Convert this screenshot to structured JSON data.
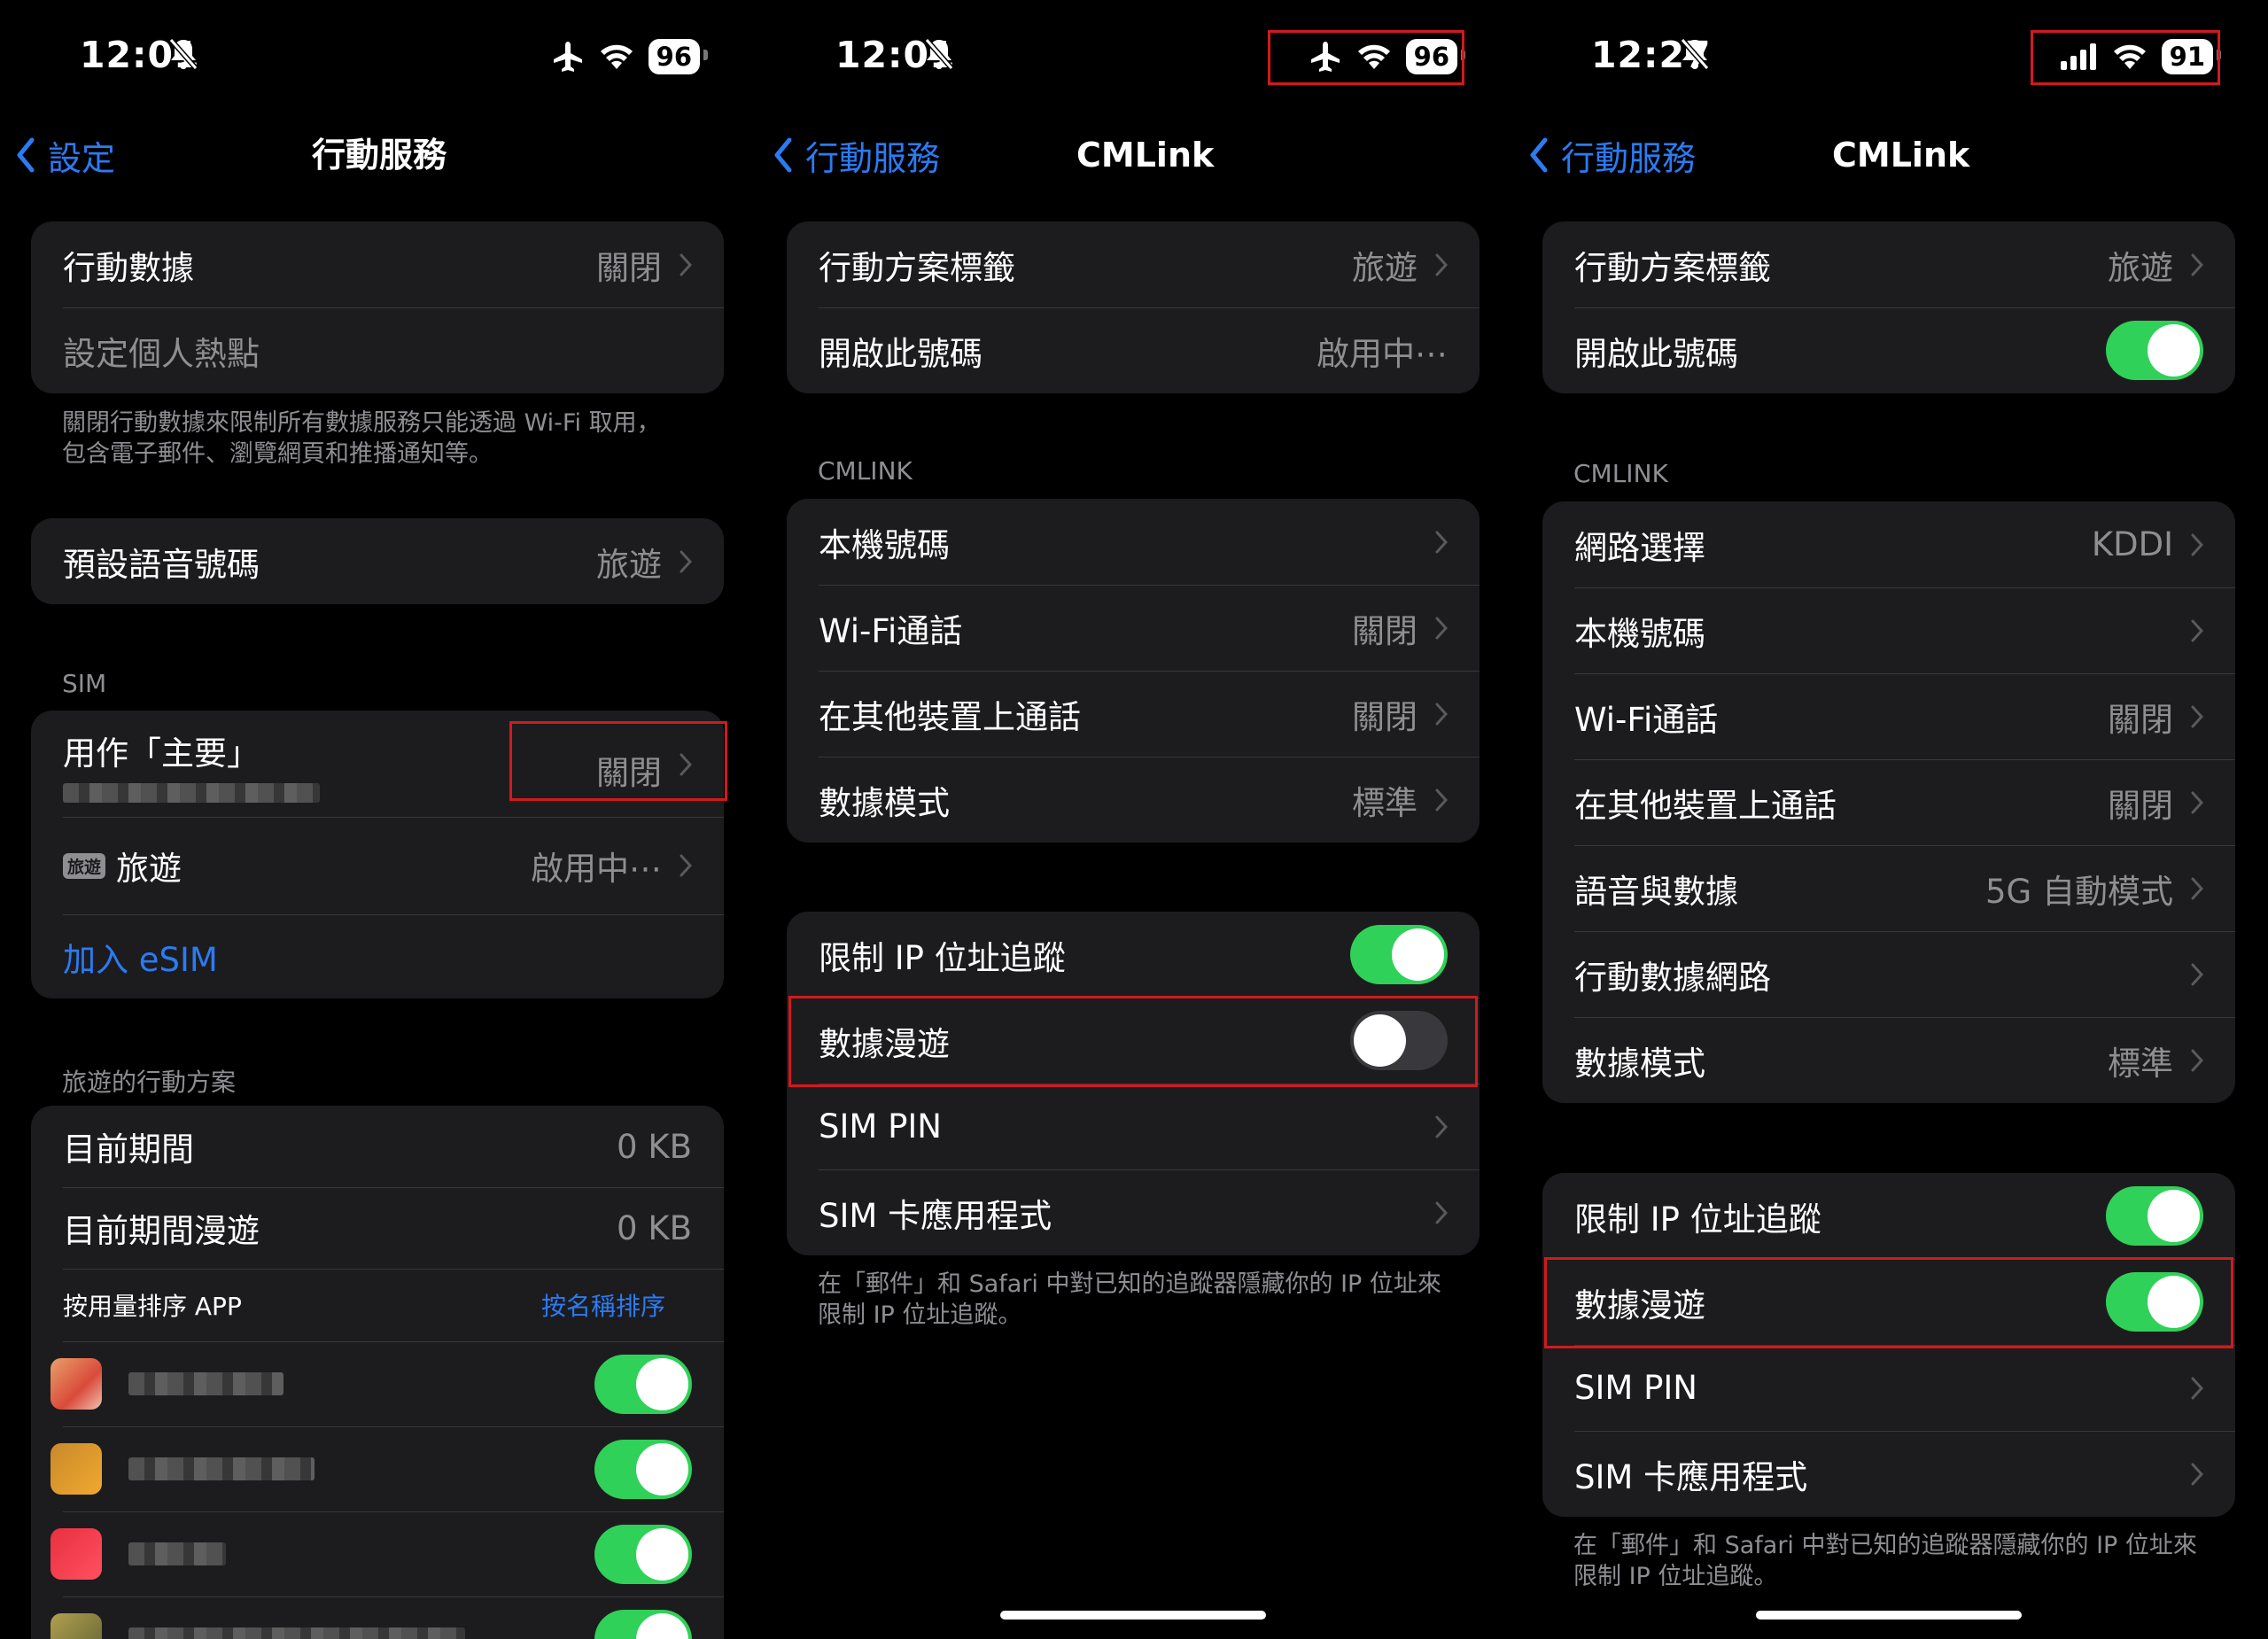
{
  "colors": {
    "accent": "#2b7bf3",
    "toggle_on": "#30d158",
    "highlight": "#d11a1e"
  },
  "panel1": {
    "status": {
      "time": "12:01",
      "battery": "96",
      "icons": [
        "silent-bell-icon",
        "airplane-icon",
        "wifi-icon",
        "battery-icon"
      ]
    },
    "nav": {
      "back": "設定",
      "title": "行動服務"
    },
    "group1": {
      "cellular_data": {
        "label": "行動數據",
        "value": "關閉"
      },
      "hotspot": {
        "label": "設定個人熱點"
      }
    },
    "footer1_line1": "關閉行動數據來限制所有數據服務只能透過 Wi-Fi 取用，",
    "footer1_line2": "包含電子郵件、瀏覽網頁和推播通知等。",
    "default_voice": {
      "label": "預設語音號碼",
      "value": "旅遊"
    },
    "sim_header": "SIM",
    "sim": {
      "primary": {
        "label": "用作「主要」",
        "value": "關閉"
      },
      "travel": {
        "badge": "旅遊",
        "label": "旅遊",
        "value": "啟用中⋯"
      },
      "add_esim": "加入 eSIM"
    },
    "plan_header": "旅遊的行動方案",
    "usage": {
      "current": {
        "label": "目前期間",
        "value": "0 KB"
      },
      "roaming": {
        "label": "目前期間漫遊",
        "value": "0 KB"
      },
      "sort_label": "按用量排序 APP",
      "sort_link": "按名稱排序"
    }
  },
  "panel2": {
    "status": {
      "time": "12:01",
      "battery": "96",
      "icons": [
        "silent-bell-icon",
        "airplane-icon",
        "wifi-icon",
        "battery-icon"
      ]
    },
    "nav": {
      "back": "行動服務",
      "title": "CMLink"
    },
    "plan_label": {
      "label": "行動方案標籤",
      "value": "旅遊"
    },
    "turn_on": {
      "label": "開啟此號碼",
      "value": "啟用中⋯"
    },
    "section_header": "CMLINK",
    "rows": [
      {
        "label": "本機號碼",
        "value": ""
      },
      {
        "label": "Wi-Fi通話",
        "value": "關閉"
      },
      {
        "label": "在其他裝置上通話",
        "value": "關閉"
      },
      {
        "label": "數據模式",
        "value": "標準"
      }
    ],
    "limit_ip": {
      "label": "限制 IP 位址追蹤",
      "on": true
    },
    "data_roaming": {
      "label": "數據漫遊",
      "on": false
    },
    "sim_pin": "SIM PIN",
    "sim_app": "SIM 卡應用程式",
    "footer_line1": "在「郵件」和 Safari 中對已知的追蹤器隱藏你的 IP 位址來",
    "footer_line2": "限制 IP 位址追蹤。"
  },
  "panel3": {
    "status": {
      "time": "12:27",
      "battery": "91",
      "icons": [
        "silent-bell-icon",
        "cellular-signal-icon",
        "wifi-icon",
        "battery-icon"
      ]
    },
    "nav": {
      "back": "行動服務",
      "title": "CMLink"
    },
    "plan_label": {
      "label": "行動方案標籤",
      "value": "旅遊"
    },
    "turn_on": {
      "label": "開啟此號碼",
      "on": true
    },
    "section_header": "CMLINK",
    "rows": [
      {
        "label": "網路選擇",
        "value": "KDDI"
      },
      {
        "label": "本機號碼",
        "value": ""
      },
      {
        "label": "Wi-Fi通話",
        "value": "關閉"
      },
      {
        "label": "在其他裝置上通話",
        "value": "關閉"
      },
      {
        "label": "語音與數據",
        "value": "5G 自動模式"
      },
      {
        "label": "行動數據網路",
        "value": ""
      },
      {
        "label": "數據模式",
        "value": "標準"
      }
    ],
    "limit_ip": {
      "label": "限制 IP 位址追蹤",
      "on": true
    },
    "data_roaming": {
      "label": "數據漫遊",
      "on": true
    },
    "sim_pin": "SIM PIN",
    "sim_app": "SIM 卡應用程式",
    "footer_line1": "在「郵件」和 Safari 中對已知的追蹤器隱藏你的 IP 位址來",
    "footer_line2": "限制 IP 位址追蹤。"
  }
}
